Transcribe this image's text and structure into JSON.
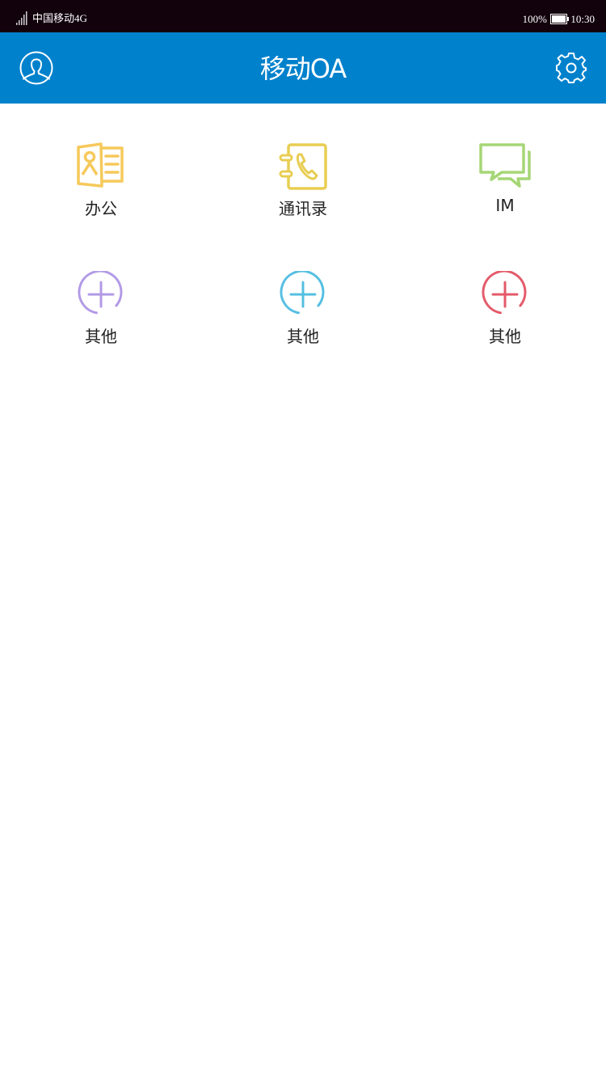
{
  "status_bar": {
    "carrier": "中国移动4G",
    "battery_percent": "100%",
    "time": "10:30",
    "icons": [
      "signal-icon",
      "battery-icon"
    ]
  },
  "header": {
    "title": "移动OA",
    "left_icon": "user-profile-icon",
    "right_icon": "settings-gear-icon",
    "background_color": "#0081cc"
  },
  "grid": {
    "items": [
      {
        "label": "办公",
        "icon": "office-contact-card-icon",
        "color": "#f6c95b"
      },
      {
        "label": "通讯录",
        "icon": "address-book-phone-icon",
        "color": "#e8cd52"
      },
      {
        "label": "IM",
        "icon": "chat-bubbles-icon",
        "color": "#a6d676"
      },
      {
        "label": "其他",
        "icon": "add-circle-icon",
        "color": "#b29ae6"
      },
      {
        "label": "其他",
        "icon": "add-circle-icon",
        "color": "#55bfe2"
      },
      {
        "label": "其他",
        "icon": "add-circle-icon",
        "color": "#e45a6a"
      }
    ]
  }
}
